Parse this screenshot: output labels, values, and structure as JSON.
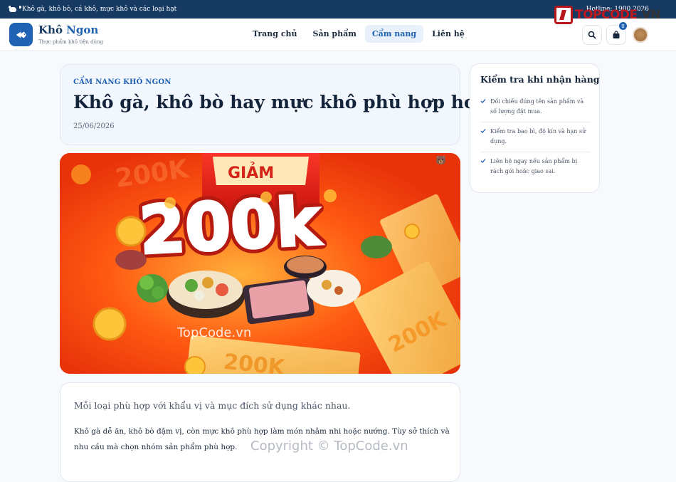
{
  "topbar": {
    "text": "Khô gà, khô bò, cá khô, mực khô và các loại hạt",
    "hotline": "Hotline: 1900 2026"
  },
  "brand": {
    "name_part1": "Khô ",
    "name_part2": "Ngon",
    "tagline": "Thực phẩm khô tiện dùng"
  },
  "nav": {
    "items": [
      {
        "label": "Trang chủ"
      },
      {
        "label": "Sản phẩm"
      },
      {
        "label": "Cẩm nang"
      },
      {
        "label": "Liên hệ"
      }
    ],
    "active": "Cẩm nang"
  },
  "cart": {
    "count": "0"
  },
  "watermark": {
    "logo_red": "TOPCODE",
    "logo_dark": ".VN",
    "hero": "TopCode.vn",
    "footer": "Copyright © TopCode.vn"
  },
  "article": {
    "kicker": "CẨM NANG KHÔ NGON",
    "title": "Khô gà, khô bò hay mực khô phù hợp hơn?",
    "date": "25/06/2026",
    "lead": "Mỗi loại phù hợp với khẩu vị và mục đích sử dụng khác nhau.",
    "body": "Khô gà dễ ăn, khô bò đậm vị, còn mực khô phù hợp làm món nhâm nhi hoặc nướng. Tùy sở thích và nhu cầu mà chọn nhóm sản phẩm phù hợp."
  },
  "hero": {
    "badge": "GIẢM",
    "amount": "200k",
    "ticket1": "200K",
    "ticket2": "200K",
    "ticket3": "200K",
    "ticket4": "200K"
  },
  "sidebar": {
    "title": "Kiểm tra khi nhận hàng",
    "items": [
      {
        "text": "Đối chiếu đúng tên sản phẩm và số lượng đặt mua."
      },
      {
        "text": "Kiểm tra bao bì, độ kín và hạn sử dụng."
      },
      {
        "text": "Liên hệ ngay nếu sản phẩm bị rách gói hoặc giao sai."
      }
    ]
  },
  "colors": {
    "topbar": "#173a63",
    "accent": "#1f62b3",
    "hero": "#ff4a10"
  }
}
